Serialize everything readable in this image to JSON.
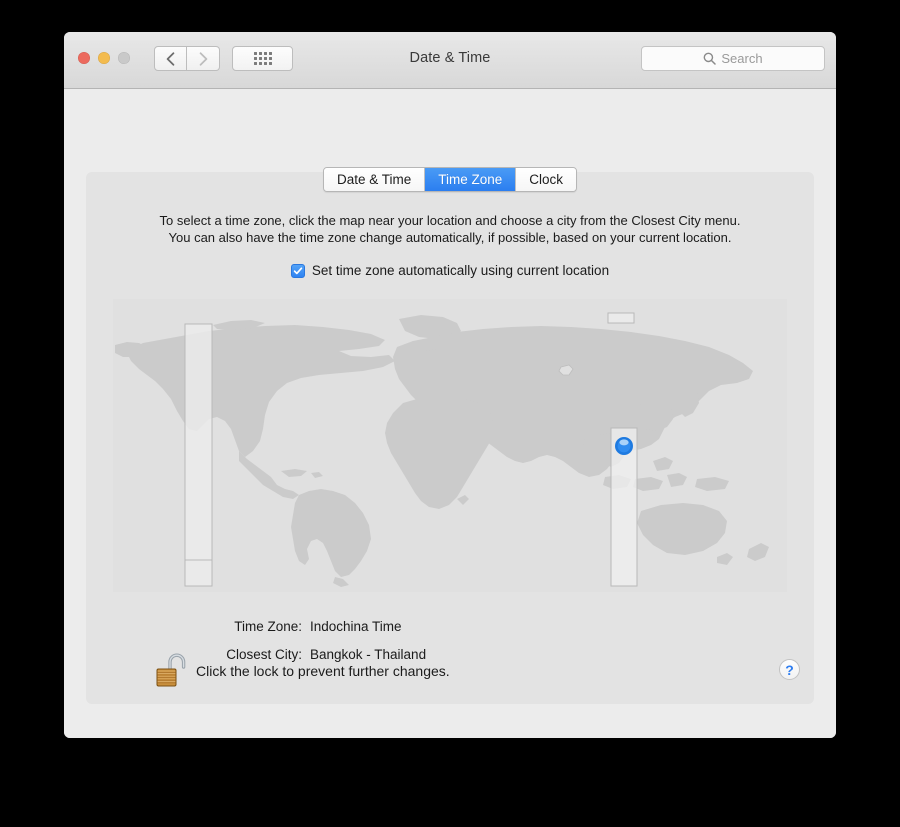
{
  "window": {
    "title": "Date & Time",
    "traffic_lights": [
      {
        "name": "close",
        "color": "#ec6a5e"
      },
      {
        "name": "minimize",
        "color": "#f3bb4e"
      },
      {
        "name": "zoom",
        "color": "#c9c9c9"
      }
    ],
    "nav": {
      "back_icon": "chevron-left-icon",
      "forward_icon": "chevron-right-icon"
    },
    "show_all_icon": "grid-dots-icon"
  },
  "search": {
    "placeholder": "Search",
    "value": "",
    "icon": "search-icon"
  },
  "tabs": [
    {
      "label": "Date & Time",
      "active": false
    },
    {
      "label": "Time Zone",
      "active": true
    },
    {
      "label": "Clock",
      "active": false
    }
  ],
  "panel": {
    "description_line1": "To select a time zone, click the map near your location and choose a city from the Closest City menu.",
    "description_line2": "You can also have the time zone change automatically, if possible, based on your current location.",
    "auto_timezone": {
      "label": "Set time zone automatically using current location",
      "checked": true,
      "check_glyph": "✓"
    },
    "info": [
      {
        "key": "Time Zone:",
        "value": "Indochina Time"
      },
      {
        "key": "Closest City:",
        "value": "Bangkok - Thailand"
      }
    ]
  },
  "map": {
    "land_color": "#cbcbcb",
    "ocean_color": "#e0e0e0",
    "highlight_band_color": "#eaeaea",
    "highlight_band_stroke": "#b9b9b9",
    "pin_color": "#1e7ae0",
    "pin_highlight": "#8fc4f7",
    "pin_name": "location-pin-marker"
  },
  "footer": {
    "lock_icon": "unlocked-padlock-icon",
    "lock_state": "unlocked",
    "lock_text": "Click the lock to prevent further changes.",
    "help_label": "?",
    "help_icon": "help-question-icon"
  },
  "colors": {
    "accent": "#2b7ef0",
    "window_bg": "#ececec",
    "panel_bg": "#e3e3e3",
    "desktop_bg": "#000000"
  }
}
